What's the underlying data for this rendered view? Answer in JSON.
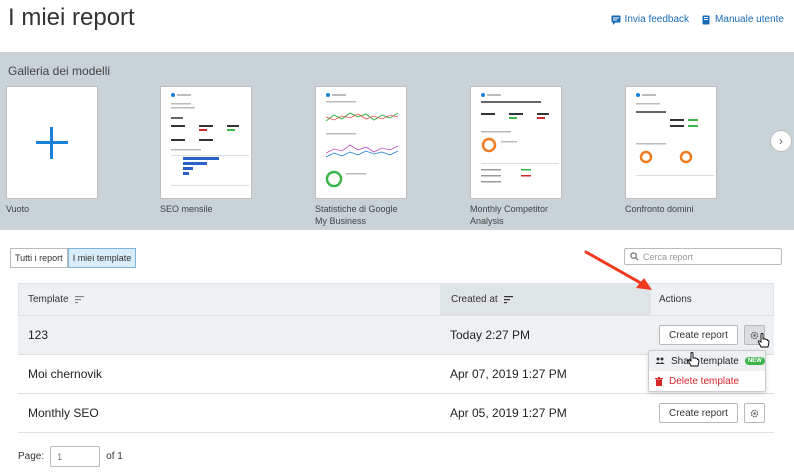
{
  "header": {
    "title": "I miei report",
    "feedback_label": "Invia feedback",
    "manual_label": "Manuale utente"
  },
  "gallery": {
    "title": "Galleria dei modelli",
    "templates": [
      {
        "label": "Vuoto"
      },
      {
        "label": "SEO mensile"
      },
      {
        "label": "Statistiche di Google My Business"
      },
      {
        "label": "Monthly Competitor Analysis"
      },
      {
        "label": "Confronto domini"
      }
    ]
  },
  "filters": {
    "all_label": "Tutti i report",
    "mine_label": "I miei template",
    "search_placeholder": "Cerca report"
  },
  "table": {
    "columns": {
      "template": "Template",
      "created": "Created at",
      "actions": "Actions"
    },
    "rows": [
      {
        "name": "123",
        "created": "Today 2:27 PM"
      },
      {
        "name": "Moi chernovik",
        "created": "Apr 07, 2019 1:27 PM"
      },
      {
        "name": "Monthly SEO",
        "created": "Apr 05, 2019 1:27 PM"
      }
    ],
    "create_label": "Create report"
  },
  "dropdown": {
    "share_label": "Share template",
    "new_badge": "NEW",
    "delete_label": "Delete template"
  },
  "pager": {
    "label": "Page:",
    "placeholder": "1",
    "of_label": "of 1"
  },
  "colors": {
    "accent": "#1a6bb5",
    "gallery_bg": "#c9d2d6",
    "danger": "#d6262a",
    "arrow": "#f0391f",
    "badge": "#3bb44a"
  }
}
